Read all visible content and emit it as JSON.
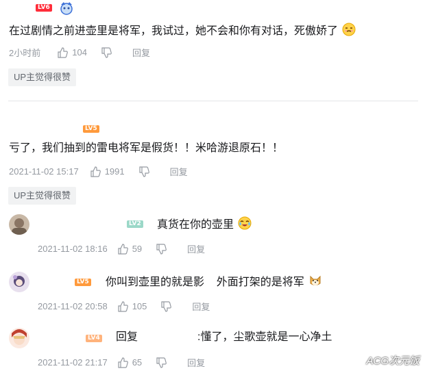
{
  "comments": [
    {
      "level": "LV6",
      "text": "在过剧情之前进壶里是将军，我试过，她不会和你有对话，死傲娇了",
      "time": "2小时前",
      "likes": "104",
      "reply": "回复",
      "badge": "UP主觉得很赞"
    },
    {
      "level": "LV5",
      "text": "亏了，我们抽到的雷电将军是假货！！米哈游退原石！！",
      "time": "2021-11-02 15:17",
      "likes": "1991",
      "reply": "回复",
      "badge": "UP主觉得很赞"
    }
  ],
  "replies": [
    {
      "level": "LV2",
      "text": "真货在你的壶里",
      "time": "2021-11-02 18:16",
      "likes": "59",
      "reply": "回复"
    },
    {
      "level": "LV5",
      "text": "你叫到壶里的就是影    外面打架的是将军",
      "time": "2021-11-02 20:58",
      "likes": "105",
      "reply": "回复"
    },
    {
      "level": "LV4",
      "prefix": "回复",
      "text": ":懂了，尘歌壶就是一心净土",
      "time": "2021-11-02 21:17",
      "likes": "65",
      "reply": "回复"
    }
  ],
  "watermark": "ACG次元饭",
  "colors": {
    "lv6": "#ff2d3a",
    "lv5": "#ff9a3c",
    "lv4": "#ffb37c",
    "lv2": "#9bd8c8",
    "meta": "#9499a0",
    "badge_bg": "#f1f2f3"
  }
}
